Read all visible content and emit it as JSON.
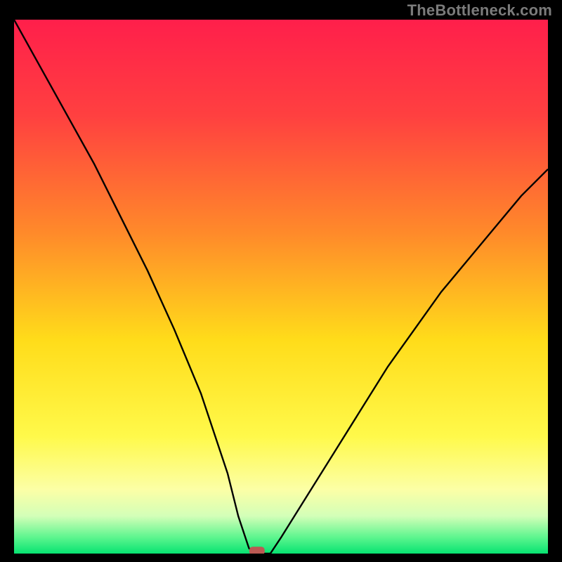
{
  "watermark": "TheBottleneck.com",
  "chart_data": {
    "type": "line",
    "title": "",
    "xlabel": "",
    "ylabel": "",
    "xlim": [
      0,
      100
    ],
    "ylim": [
      0,
      100
    ],
    "x": [
      0,
      5,
      10,
      15,
      20,
      25,
      30,
      35,
      40,
      42,
      44,
      45,
      48,
      50,
      55,
      60,
      65,
      70,
      75,
      80,
      85,
      90,
      95,
      100
    ],
    "values": [
      100,
      91,
      82,
      73,
      63,
      53,
      42,
      30,
      15,
      7,
      1,
      0,
      0,
      3,
      11,
      19,
      27,
      35,
      42,
      49,
      55,
      61,
      67,
      72
    ],
    "marker": {
      "x": 45.5,
      "y": 0.5
    },
    "gradient_stops": [
      {
        "offset": 0.0,
        "color": "#ff1f4b"
      },
      {
        "offset": 0.18,
        "color": "#ff4040"
      },
      {
        "offset": 0.4,
        "color": "#ff8a2a"
      },
      {
        "offset": 0.6,
        "color": "#ffdc1a"
      },
      {
        "offset": 0.78,
        "color": "#fff94a"
      },
      {
        "offset": 0.88,
        "color": "#fcffa6"
      },
      {
        "offset": 0.93,
        "color": "#d3ffb8"
      },
      {
        "offset": 0.97,
        "color": "#5cf58e"
      },
      {
        "offset": 1.0,
        "color": "#07e371"
      }
    ],
    "marker_color": "#bb5a53",
    "line_color": "#000000"
  }
}
